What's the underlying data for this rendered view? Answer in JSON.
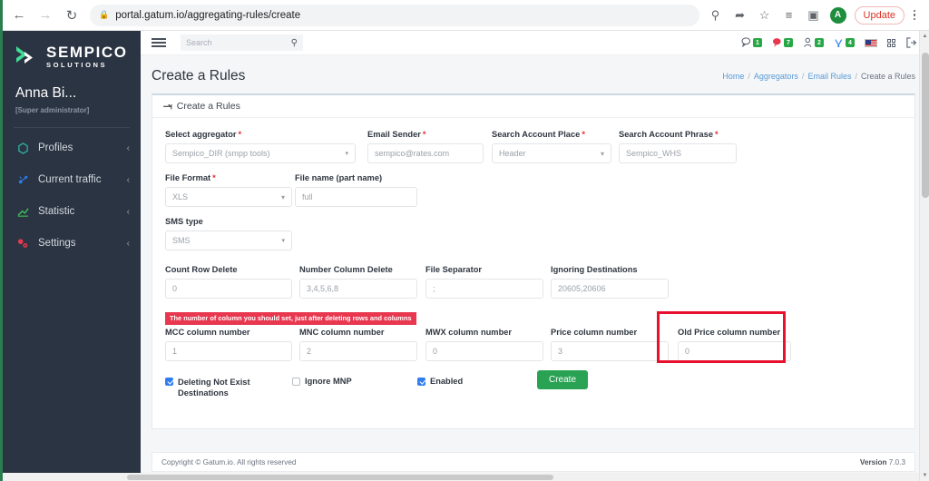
{
  "browser": {
    "back_icon": "back-arrow-icon",
    "forward_icon": "forward-arrow-icon",
    "reload_icon": "reload-icon",
    "lock_icon": "lock-icon",
    "url": "portal.gatum.io/aggregating-rules/create",
    "icons": [
      "search-icon",
      "share-icon",
      "bookmark-star-icon",
      "reading-list-icon",
      "split-view-icon"
    ],
    "profile_initial": "A",
    "update_label": "Update",
    "menu_icon": "kebab-menu-icon"
  },
  "sidebar": {
    "logo_primary": "SEMPICO",
    "logo_secondary": "SOLUTIONS",
    "user_name": "Anna Bi...",
    "user_role": "[Super administrator]",
    "items": [
      {
        "label": "Profiles",
        "icon": "profiles-icon",
        "color": "#2bb3a3",
        "chevron": "‹"
      },
      {
        "label": "Current traffic",
        "icon": "traffic-icon",
        "color": "#2f7ef0",
        "chevron": "‹"
      },
      {
        "label": "Statistic",
        "icon": "statistic-icon",
        "color": "#3fbf5a",
        "chevron": "‹"
      },
      {
        "label": "Settings",
        "icon": "settings-icon",
        "color": "#e8384f",
        "chevron": "‹"
      }
    ]
  },
  "topbar": {
    "menu_toggle": "hamburger-icon",
    "search_placeholder": "Search",
    "search_icon": "search-icon",
    "indicators": [
      {
        "name": "messages-icon",
        "count": "1",
        "color": "#27a745"
      },
      {
        "name": "alerts-icon",
        "count": "7",
        "color": "#27a745"
      },
      {
        "name": "users-icon",
        "count": "2",
        "color": "#27a745"
      },
      {
        "name": "tickets-icon",
        "count": "4",
        "color": "#27a745"
      }
    ],
    "language_icon": "us-flag-icon",
    "apps_icon": "grid-apps-icon",
    "logout_icon": "logout-icon"
  },
  "page": {
    "title": "Create a Rules",
    "breadcrumb": [
      {
        "label": "Home",
        "link": true
      },
      {
        "label": "Aggregators",
        "link": true
      },
      {
        "label": "Email Rules",
        "link": true
      },
      {
        "label": "Create a Rules",
        "link": false
      }
    ],
    "separator": "/"
  },
  "card": {
    "header_icon": "magnet-icon",
    "header_title": "Create a Rules",
    "warning": "The number of column you should set, just after deleting rows and columns",
    "fields": {
      "select_aggregator": {
        "label": "Select aggregator",
        "required": true,
        "value": "Sempico_DIR (smpp tools)",
        "type": "select"
      },
      "email_sender": {
        "label": "Email Sender",
        "required": true,
        "value": "sempico@rates.com",
        "type": "input"
      },
      "search_account_place": {
        "label": "Search Account Place",
        "required": true,
        "value": "Header",
        "type": "select"
      },
      "search_account_phrase": {
        "label": "Search Account Phrase",
        "required": true,
        "value": "Sempico_WHS",
        "type": "input"
      },
      "file_format": {
        "label": "File Format",
        "required": true,
        "value": "XLS",
        "type": "select"
      },
      "file_name": {
        "label": "File name (part name)",
        "required": false,
        "value": "full",
        "type": "input"
      },
      "sms_type": {
        "label": "SMS type",
        "required": false,
        "value": "SMS",
        "type": "select"
      },
      "count_row_delete": {
        "label": "Count Row Delete",
        "required": false,
        "value": "0",
        "type": "input"
      },
      "number_column_delete": {
        "label": "Number Column Delete",
        "required": false,
        "value": "3,4,5,6,8",
        "type": "input"
      },
      "file_separator": {
        "label": "File Separator",
        "required": false,
        "value": ";",
        "type": "input"
      },
      "ignoring_destinations": {
        "label": "Ignoring Destinations",
        "required": false,
        "value": "20605,20606",
        "type": "input"
      },
      "mcc_column_number": {
        "label": "MCC column number",
        "required": false,
        "value": "1",
        "type": "input"
      },
      "mnc_column_number": {
        "label": "MNC column number",
        "required": false,
        "value": "2",
        "type": "input"
      },
      "mwx_column_number": {
        "label": "MWX column number",
        "required": false,
        "value": "0",
        "type": "input"
      },
      "price_column_number": {
        "label": "Price column number",
        "required": false,
        "value": "3",
        "type": "input"
      },
      "old_price_column_number": {
        "label": "Old Price column number",
        "required": false,
        "value": "0",
        "type": "input"
      }
    },
    "checkboxes": [
      {
        "label": "Deleting Not Exist Destinations",
        "checked": true
      },
      {
        "label": "Ignore MNP",
        "checked": false
      },
      {
        "label": "Enabled",
        "checked": true
      }
    ],
    "submit_label": "Create",
    "highlight_color": "#e8112d"
  },
  "footer": {
    "copyright": "Copyright © Gatum.io. All rights reserved",
    "version_label": "Version",
    "version_value": "7.0.3"
  }
}
